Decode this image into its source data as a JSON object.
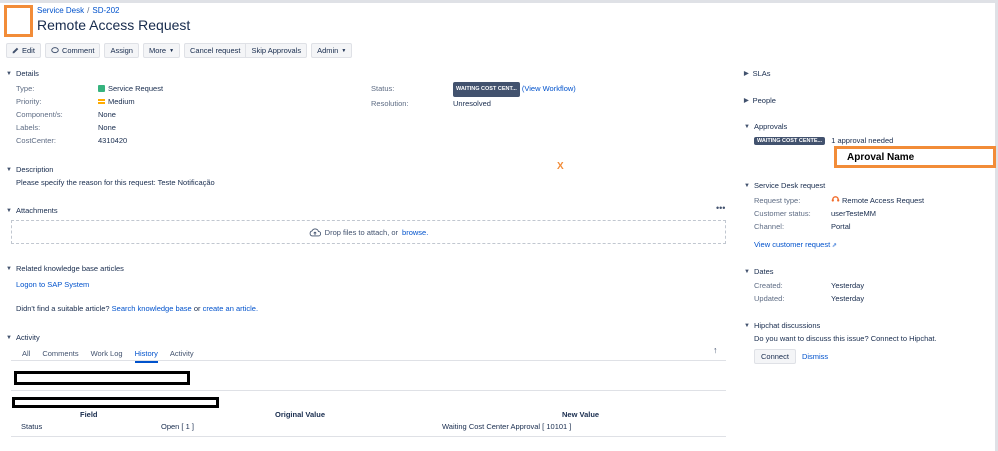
{
  "breadcrumb": {
    "project": "Service Desk",
    "issue_key": "SD-202"
  },
  "title": "Remote Access Request",
  "toolbar": {
    "edit": "Edit",
    "comment": "Comment",
    "assign": "Assign",
    "more": "More",
    "cancel_request": "Cancel request",
    "skip_approvals": "Skip Approvals",
    "admin": "Admin"
  },
  "details": {
    "heading": "Details",
    "type_label": "Type:",
    "type_value": "Service Request",
    "priority_label": "Priority:",
    "priority_value": "Medium",
    "components_label": "Component/s:",
    "components_value": "None",
    "labels_label": "Labels:",
    "labels_value": "None",
    "costcenter_label": "CostCenter:",
    "costcenter_value": "4310420",
    "status_label": "Status:",
    "status_value": "WAITING COST CENT...",
    "view_workflow": "(View Workflow)",
    "resolution_label": "Resolution:",
    "resolution_value": "Unresolved"
  },
  "description": {
    "heading": "Description",
    "text": "Please specify the reason for this request: Teste Notificação",
    "marker": "X"
  },
  "attachments": {
    "heading": "Attachments",
    "drop_text": "Drop files to attach, or",
    "browse": "browse."
  },
  "kb": {
    "heading": "Related knowledge base articles",
    "article": "Logon to SAP System",
    "prompt": "Didn't find a suitable article?",
    "search": "Search knowledge base",
    "or": "or",
    "create": "create an article."
  },
  "activity": {
    "heading": "Activity",
    "tabs": [
      "All",
      "Comments",
      "Work Log",
      "History",
      "Activity"
    ],
    "history": {
      "col_field": "Field",
      "col_original": "Original Value",
      "col_new": "New Value",
      "row_field": "Status",
      "row_original": "Open [ 1 ]",
      "row_new": "Waiting Cost Center Approval [ 10101 ]"
    }
  },
  "sidebar": {
    "slas": "SLAs",
    "people": "People",
    "approvals": {
      "heading": "Approvals",
      "status": "WAITING COST CENTE...",
      "needed": "1 approval needed",
      "annotation": "Aproval Name"
    },
    "sd_request": {
      "heading": "Service Desk request",
      "request_type_label": "Request type:",
      "request_type_value": "Remote Access Request",
      "customer_status_label": "Customer status:",
      "customer_status_value": "userTesteMM",
      "channel_label": "Channel:",
      "channel_value": "Portal",
      "view_link": "View customer request"
    },
    "dates": {
      "heading": "Dates",
      "created_label": "Created:",
      "created_value": "Yesterday",
      "updated_label": "Updated:",
      "updated_value": "Yesterday"
    },
    "hipchat": {
      "heading": "Hipchat discussions",
      "prompt": "Do you want to discuss this issue? Connect to Hipchat.",
      "connect": "Connect",
      "dismiss": "Dismiss"
    }
  },
  "colors": {
    "annotation": "#f28c38",
    "link": "#0052cc",
    "lozenge": "#42526e"
  }
}
